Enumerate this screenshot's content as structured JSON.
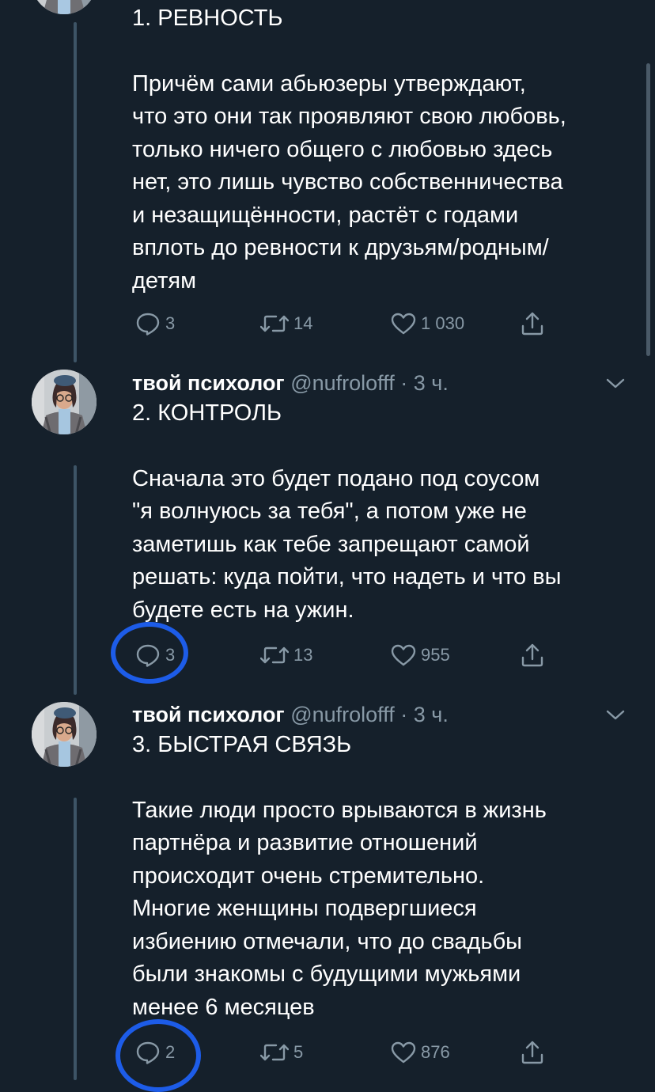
{
  "colors": {
    "background": "#15202b",
    "text": "#ffffff",
    "secondary": "#8899a6",
    "thread_line": "#3d5466",
    "highlight": "#1d5ce8"
  },
  "tweets": [
    {
      "title": "1. РЕВНОСТЬ",
      "body": "Причём сами абьюзеры утверждают,\nчто это они так проявляют свою любовь,\nтолько ничего общего с любовью здесь\nнет, это лишь чувство собственничества\nи незащищённости, растёт с годами\nвплоть до ревности к друзьям/родным/\nдетям",
      "replies": "3",
      "retweets": "14",
      "likes": "1 030"
    },
    {
      "name": "твой психолог",
      "handle": "@nufrolofff",
      "separator": "·",
      "time": "3 ч.",
      "title": "2. КОНТРОЛЬ",
      "body": "Сначала это будет подано под соусом\n\"я волнуюсь за тебя\", а потом уже не\nзаметишь как тебе запрещают самой\nрешать: куда пойти, что надеть и что вы\nбудете есть на ужин.",
      "replies": "3",
      "retweets": "13",
      "likes": "955"
    },
    {
      "name": "твой психолог",
      "handle": "@nufrolofff",
      "separator": "·",
      "time": "3 ч.",
      "title": "3. БЫСТРАЯ СВЯЗЬ",
      "body": "Такие люди просто врываются в жизнь\nпартнёра и развитие отношений\nпроисходит очень стремительно.\nМногие женщины подвергшиеся\nизбиению отмечали, что до свадьбы\nбыли знакомы с будущими мужьями\nменее 6 месяцев",
      "replies": "2",
      "retweets": "5",
      "likes": "876"
    }
  ]
}
